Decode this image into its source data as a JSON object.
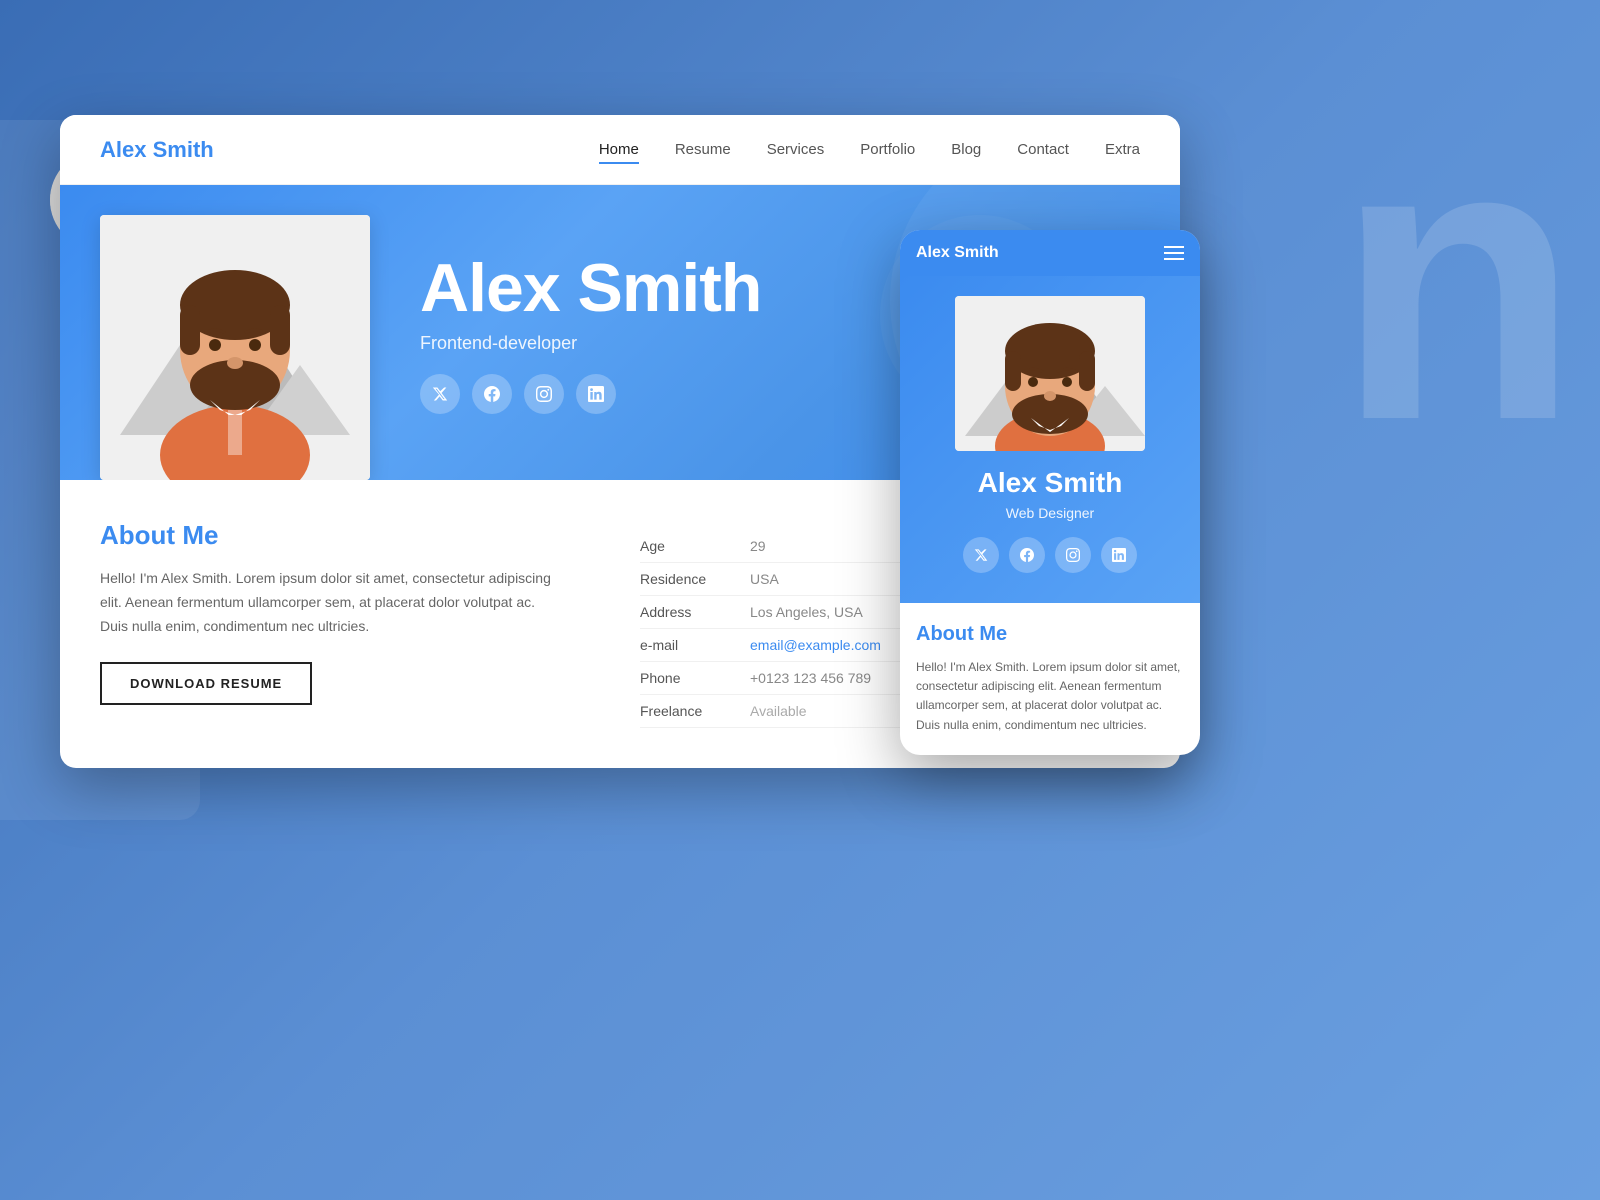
{
  "background": {
    "big_letter": "n"
  },
  "desktop": {
    "nav": {
      "logo_first": "Alex",
      "logo_second": "Smith",
      "links": [
        {
          "label": "Home",
          "active": true
        },
        {
          "label": "Resume",
          "active": false
        },
        {
          "label": "Services",
          "active": false
        },
        {
          "label": "Portfolio",
          "active": false
        },
        {
          "label": "Blog",
          "active": false
        },
        {
          "label": "Contact",
          "active": false
        },
        {
          "label": "Extra",
          "active": false
        }
      ]
    },
    "hero": {
      "name": "Alex Smith",
      "subtitle": "Frontend-developer",
      "socials": [
        "𝕏",
        "f",
        "◎",
        "in"
      ]
    },
    "about": {
      "title_plain": "About",
      "title_colored": "Me",
      "text": "Hello! I'm Alex Smith. Lorem ipsum dolor sit amet, consectetur adipiscing elit. Aenean fermentum ullamcorper sem, at placerat dolor volutpat ac. Duis nulla enim, condimentum nec ultricies.",
      "download_btn": "DOWNLOAD RESUME"
    },
    "info": {
      "rows": [
        {
          "label": "Age",
          "value": "29",
          "type": "plain"
        },
        {
          "label": "Residence",
          "value": "USA",
          "type": "plain"
        },
        {
          "label": "Address",
          "value": "Los Angeles, USA",
          "type": "plain"
        },
        {
          "label": "e-mail",
          "value": "email@example.com",
          "type": "email"
        },
        {
          "label": "Phone",
          "value": "+0123 123 456 789",
          "type": "plain"
        },
        {
          "label": "Freelance",
          "value": "Available",
          "type": "muted"
        }
      ]
    }
  },
  "mobile": {
    "nav": {
      "title": "Alex Smith"
    },
    "hero": {
      "name": "Alex Smith",
      "subtitle": "Web Designer",
      "socials": [
        "𝕏",
        "f",
        "◎",
        "in"
      ]
    },
    "about": {
      "title_plain": "About",
      "title_colored": "Me",
      "text": "Hello! I'm Alex Smith. Lorem ipsum dolor sit amet, consectetur adipiscing elit. Aenean fermentum ullamcorper sem, at placerat dolor volutpat ac. Duis nulla enim, condimentum nec ultricies."
    }
  },
  "colors": {
    "blue": "#3b8bf0",
    "dark": "#222222",
    "muted": "#888888",
    "email_color": "#3b8bf0"
  }
}
